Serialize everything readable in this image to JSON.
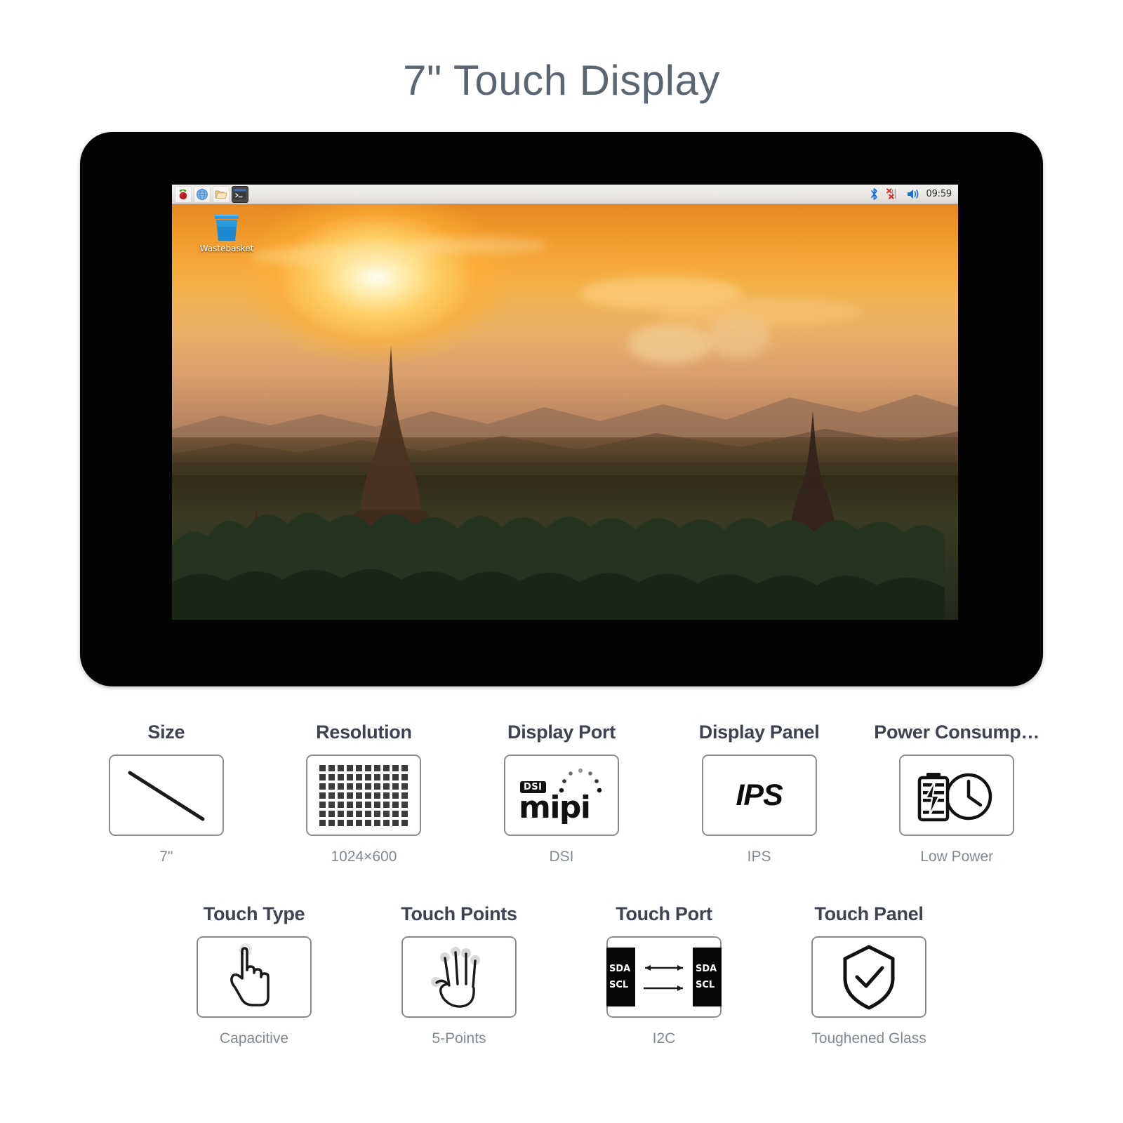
{
  "page": {
    "title": "7\" Touch Display",
    "background": "#ffffff",
    "title_color": "#5b6670"
  },
  "device": {
    "bezel_color": "#030303",
    "screen": {
      "taskbar": {
        "launchers": [
          {
            "name": "raspberry-menu-icon",
            "label": "Raspberry Pi Menu"
          },
          {
            "name": "web-browser-icon",
            "label": "Web Browser"
          },
          {
            "name": "file-manager-icon",
            "label": "File Manager"
          },
          {
            "name": "terminal-icon",
            "label": "Terminal"
          }
        ],
        "tray": [
          {
            "name": "bluetooth-icon",
            "label": "Bluetooth",
            "color": "#1a72e8"
          },
          {
            "name": "network-disconnected-icon",
            "label": "Network Disconnected",
            "color": "#d92b2b"
          },
          {
            "name": "volume-icon",
            "label": "Volume",
            "color": "#1f6fd0"
          }
        ],
        "clock": "09:59"
      },
      "desktop_icons": [
        {
          "name": "wastebasket-icon",
          "label": "Wastebasket",
          "color": "#1e8ad6"
        }
      ],
      "wallpaper": {
        "name": "bagan-sunset-wallpaper",
        "description": "Temples at sunset"
      }
    }
  },
  "features": {
    "row1": [
      {
        "title": "Size",
        "caption": "7\"",
        "icon": "diagonal-measure-icon"
      },
      {
        "title": "Resolution",
        "caption": "1024×600",
        "icon": "pixel-grid-icon"
      },
      {
        "title": "Display Port",
        "caption": "DSI",
        "icon": "mipi-dsi-logo-icon",
        "logo_word": "mipi",
        "logo_badge": "DSI"
      },
      {
        "title": "Display Panel",
        "caption": "IPS",
        "icon": "ips-text-icon",
        "logo_word": "IPS"
      },
      {
        "title": "Power Consump…",
        "caption": "Low Power",
        "icon": "battery-clock-icon"
      }
    ],
    "row2": [
      {
        "title": "Touch Type",
        "caption": "Capacitive",
        "icon": "pointing-hand-icon"
      },
      {
        "title": "Touch Points",
        "caption": "5-Points",
        "icon": "open-hand-icon"
      },
      {
        "title": "Touch Port",
        "caption": "I2C",
        "icon": "i2c-bus-icon",
        "pins": [
          "SDA",
          "SCL"
        ]
      },
      {
        "title": "Touch Panel",
        "caption": "Toughened Glass",
        "icon": "shield-check-icon"
      }
    ]
  }
}
